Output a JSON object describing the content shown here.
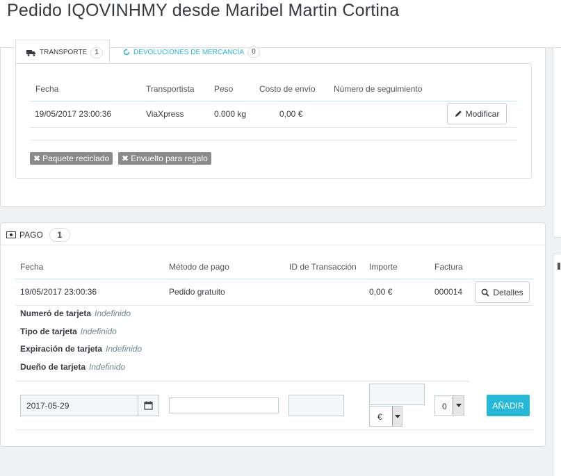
{
  "header": {
    "title": "Pedido IQOVINHMY desde Maribel Martin Cortina"
  },
  "shipping": {
    "tabs": [
      {
        "label": "Transporte",
        "count": "1",
        "icon": "truck-icon"
      },
      {
        "label": "Devoluciones de mercancía",
        "count": "0",
        "icon": "refresh-icon"
      }
    ],
    "columns": [
      "Fecha",
      "Transportista",
      "Peso",
      "Costo de envío",
      "Número de seguimiento"
    ],
    "row": {
      "date": "19/05/2017 23:00:36",
      "carrier": "ViaXpress",
      "weight": "0.000 kg",
      "cost": "0,00 €",
      "tracking": "",
      "edit_label": "Modificar"
    },
    "tags": [
      {
        "label": "Paquete reciclado",
        "icon": "close-icon"
      },
      {
        "label": "Envuelto para regalo",
        "icon": "close-icon"
      }
    ]
  },
  "payment": {
    "heading": "Pago",
    "count": "1",
    "icon": "money-icon",
    "columns": [
      "Fecha",
      "Método de pago",
      "ID de Transacción",
      "Importe",
      "Factura"
    ],
    "row": {
      "date": "19/05/2017 23:00:36",
      "method": "Pedido gratuito",
      "transaction_id": "",
      "amount": "0,00 €",
      "invoice": "000014",
      "details_label": "Detalles"
    },
    "card_details": [
      {
        "label": "Numeró de tarjeta",
        "value": "Indefinido"
      },
      {
        "label": "Tipo de tarjeta",
        "value": "Indefinido"
      },
      {
        "label": "Expiración de tarjeta",
        "value": "Indefinido"
      },
      {
        "label": "Dueño de tarjeta",
        "value": "Indefinido"
      }
    ],
    "form": {
      "date_value": "2017-05-29",
      "method_value": "",
      "transaction_value": "",
      "amount_value": "",
      "currency": "€",
      "invoice_value": "0",
      "add_label": "Añadir"
    }
  },
  "colors": {
    "accent": "#25b9d7",
    "tag_gray": "#8a8a8a",
    "background": "#eff1f2"
  }
}
